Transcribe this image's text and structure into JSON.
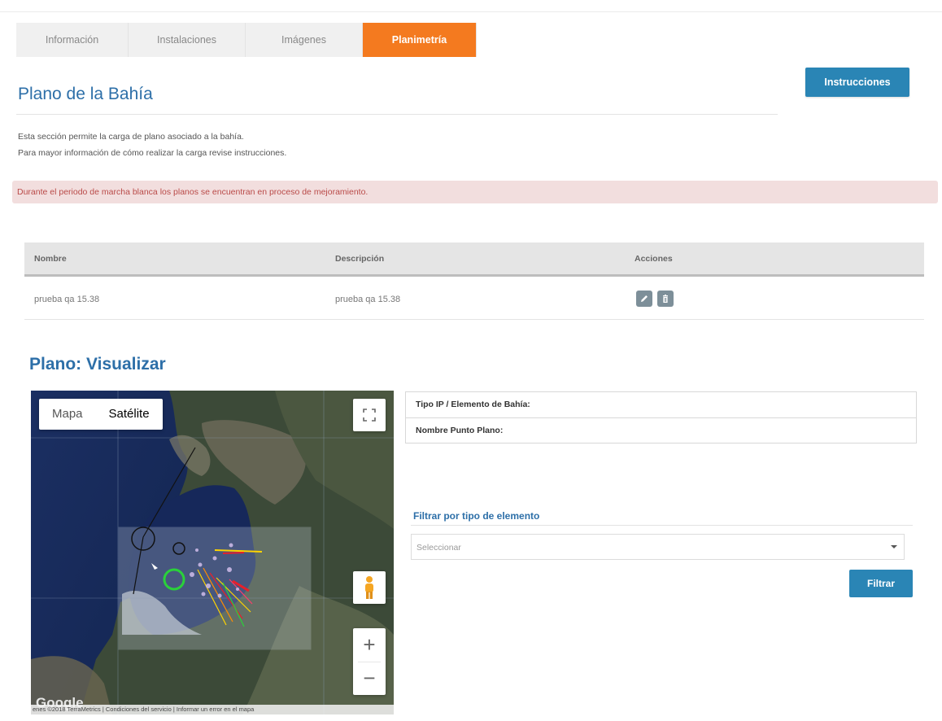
{
  "tabs": [
    {
      "label": "Información",
      "active": false
    },
    {
      "label": "Instalaciones",
      "active": false
    },
    {
      "label": "Imágenes",
      "active": false
    },
    {
      "label": "Planimetría",
      "active": true
    }
  ],
  "page_title": "Plano de la Bahía",
  "instructions_button": "Instrucciones",
  "description": {
    "line1": "Esta sección permite la carga de plano asociado a la bahía.",
    "line2": "Para mayor información de cómo realizar la carga revise instrucciones."
  },
  "alert_text": "Durante el periodo de marcha blanca los planos se encuentran en proceso de mejoramiento.",
  "table": {
    "headers": [
      "Nombre",
      "Descripción",
      "Acciones"
    ],
    "rows": [
      {
        "nombre": "prueba qa 15.38",
        "descripcion": "prueba qa 15.38"
      }
    ],
    "action_icons": [
      "pencil-icon",
      "trash-icon"
    ]
  },
  "viewer_title": "Plano: Visualizar",
  "map": {
    "type_buttons": [
      "Mapa",
      "Satélite"
    ],
    "selected_type": "Satélite",
    "zoom_in": "+",
    "zoom_out": "−",
    "logo": "Google",
    "footer": "enes ©2018 TerraMetrics | Condiciones del servicio | Informar un error en el mapa"
  },
  "info_panel": {
    "row1_label": "Tipo IP / Elemento de Bahía:",
    "row2_label": "Nombre Punto Plano:"
  },
  "filter": {
    "label": "Filtrar por tipo de elemento",
    "placeholder": "Seleccionar",
    "button": "Filtrar"
  },
  "colors": {
    "accent_orange": "#f47a1f",
    "primary_blue": "#2a85b5",
    "title_blue": "#2d6fa8",
    "alert_bg": "#f2dede",
    "alert_text": "#b94a48"
  }
}
